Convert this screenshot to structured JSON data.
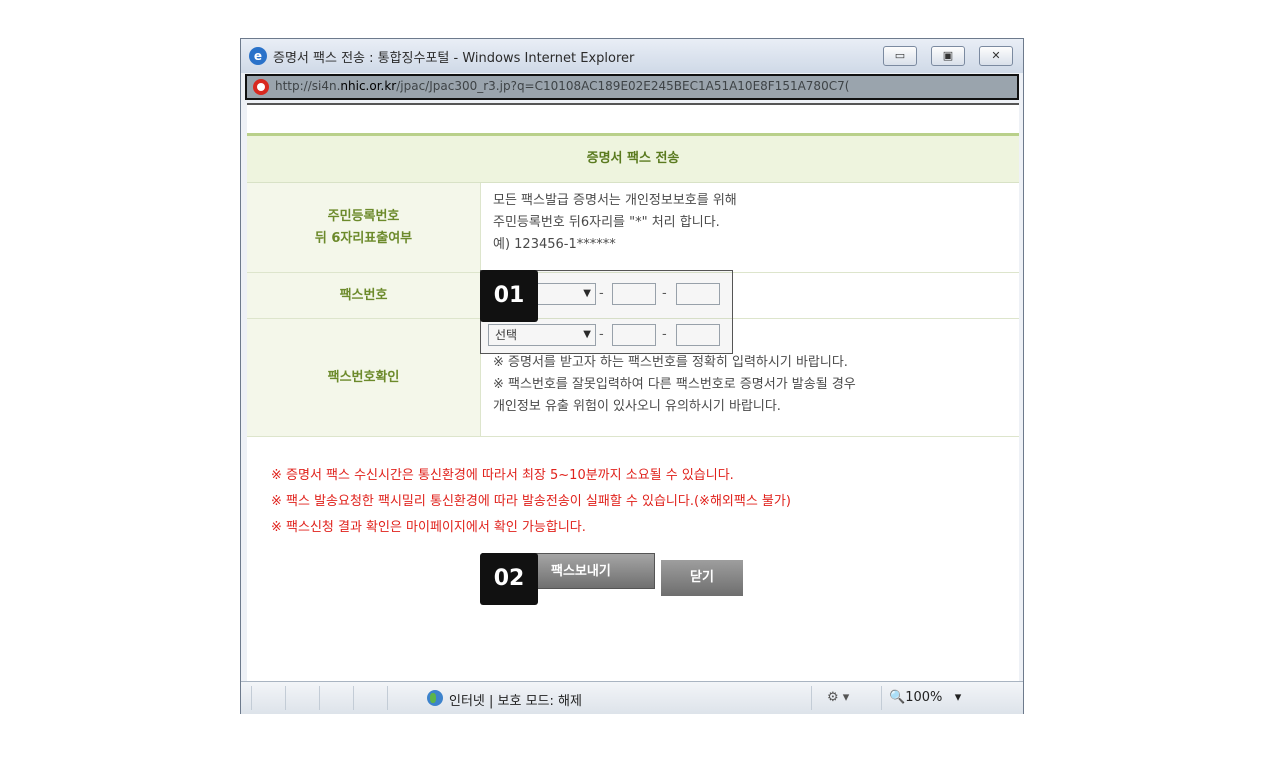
{
  "window": {
    "title": "증명서 팩스 전송 : 통합징수포털 - Windows Internet Explorer",
    "buttons": {
      "minimize": "▭",
      "maximize": "▣",
      "close": "✕"
    },
    "address": {
      "prefix": "http://si4n.",
      "host": "nhic.or.kr",
      "suffix": "/jpac/Jpac300_r3.jp?q=C10108AC189E02E245BEC1A51A10E8F151A780C7("
    }
  },
  "page": {
    "header": "증명서 팩스 전송",
    "rows": [
      {
        "label_line1": "주민등록번호",
        "label_line2": "뒤 6자리표출여부",
        "text_lines": [
          "모든 팩스발급 증명서는 개인정보보호를 위해",
          "주민등록번호 뒤6자리를 \"*\" 처리 합니다.",
          "예) 123456-1******"
        ]
      },
      {
        "label_line1": "팩스번호"
      },
      {
        "label_line1": "팩스번호확인",
        "select_value": "선택",
        "text_lines": [
          "※ 증명서를 받고자 하는 팩스번호를 정확히 입력하시기 바랍니다.",
          "※ 팩스번호를 잘못입력하여 다른 팩스번호로 증명서가 발송될 경우",
          "개인정보 유출 위험이 있사오니 유의하시기 바랍니다."
        ]
      }
    ],
    "notices": [
      "※ 증명서 팩스 수신시간은 통신환경에 따라서 최장 5~10분까지 소요될 수 있습니다.",
      "※ 팩스 발송요청한 팩시밀리 통신환경에 따라 발송전송이 실패할 수 있습니다.(※해외팩스 불가)",
      "※ 팩스신청 결과 확인은 마이페이지에서 확인 가능합니다."
    ],
    "buttons": {
      "send": "팩스보내기",
      "close": "닫기"
    }
  },
  "annotations": {
    "step1": "01",
    "step2": "02"
  },
  "statusbar": {
    "text": "인터넷 | 보호 모드: 해제",
    "zoom": "100%"
  }
}
